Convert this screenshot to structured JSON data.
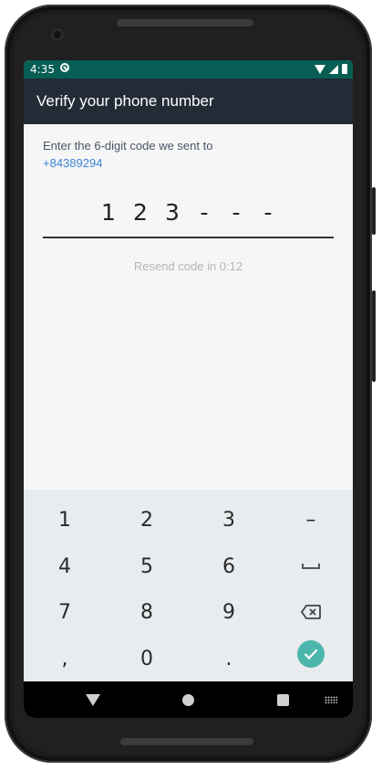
{
  "status_bar": {
    "time": "4:35"
  },
  "app_bar": {
    "title": "Verify your phone number"
  },
  "instruction": {
    "text": "Enter the 6-digit code we sent to",
    "phone_number": "+84389294"
  },
  "code": {
    "digits": [
      "1",
      "2",
      "3",
      "-",
      "-",
      "-"
    ]
  },
  "resend": {
    "text": "Resend code in 0:12"
  },
  "keypad": {
    "rows": [
      [
        "1",
        "2",
        "3",
        "–"
      ],
      [
        "4",
        "5",
        "6",
        "space"
      ],
      [
        "7",
        "8",
        "9",
        "backspace"
      ],
      [
        ",",
        "0",
        ".",
        "confirm"
      ]
    ]
  },
  "colors": {
    "status_bar": "#075e54",
    "app_bar": "#232b36",
    "link": "#3d84d8",
    "confirm": "#4db6ac"
  }
}
